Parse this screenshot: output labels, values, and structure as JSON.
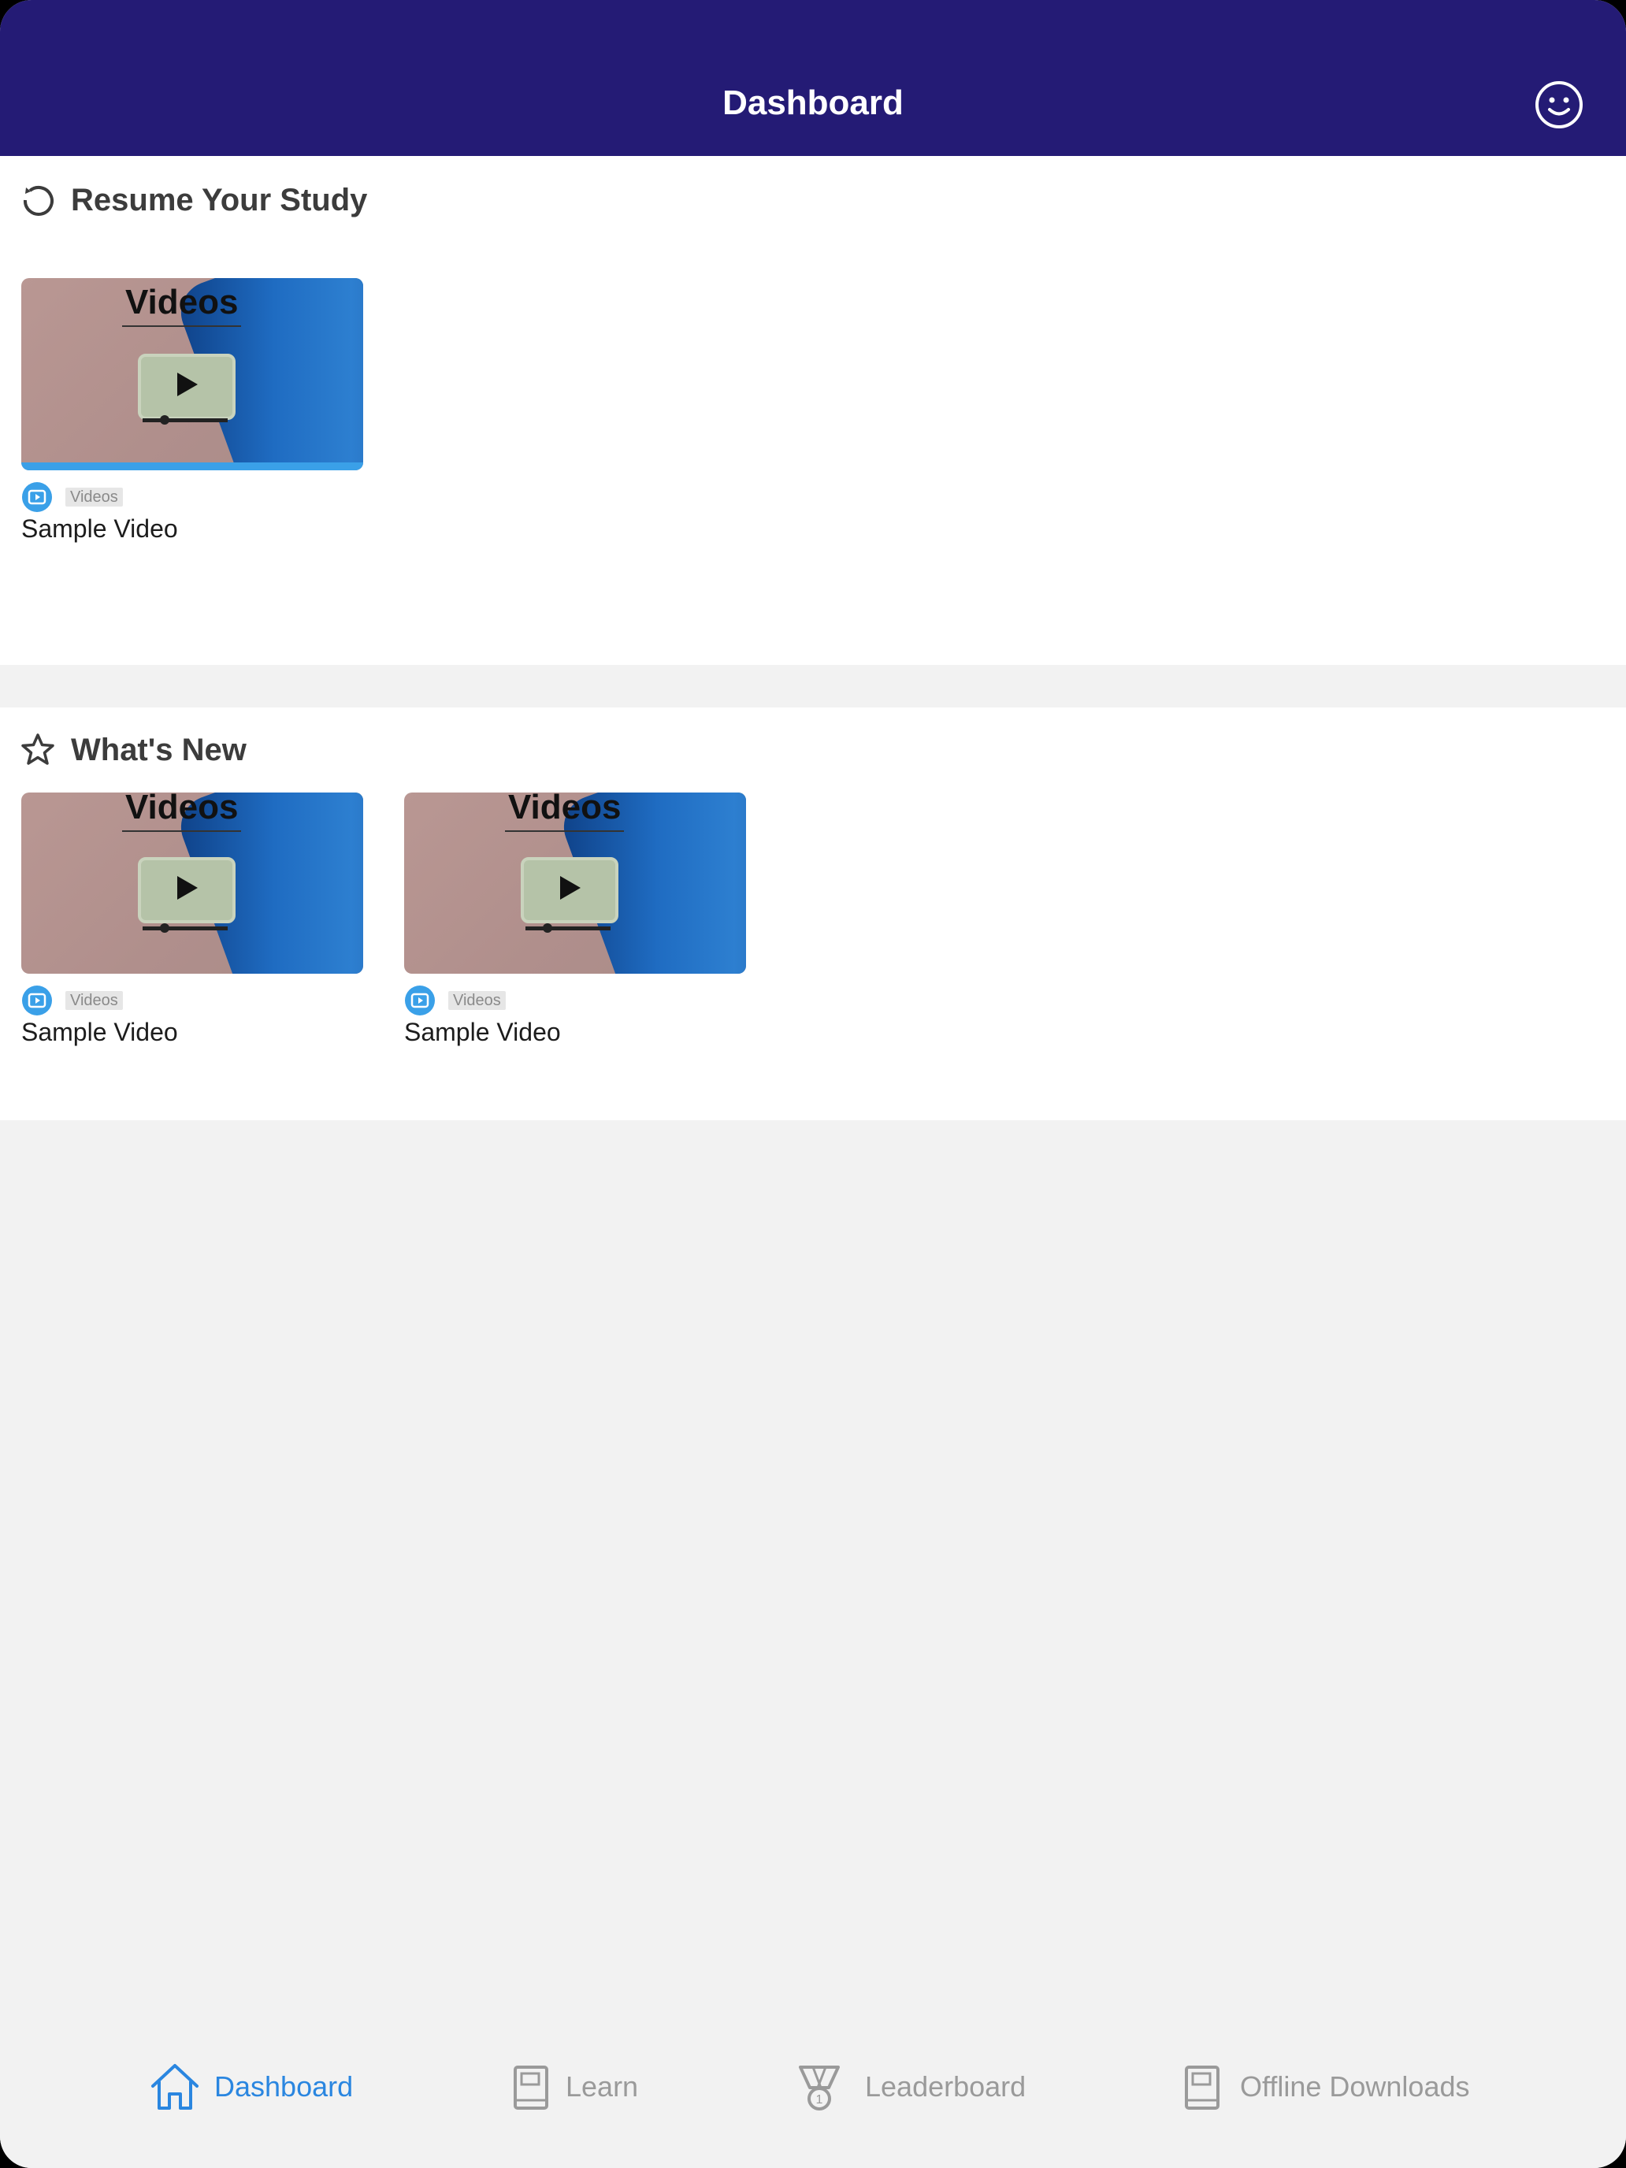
{
  "header": {
    "title": "Dashboard",
    "profile_icon": "smiley-face-icon"
  },
  "colors": {
    "header_bg": "#241b75",
    "accent": "#2a86e0",
    "video_badge": "#3aa0e8",
    "inactive": "#9a9a9a"
  },
  "resume": {
    "title": "Resume Your Study",
    "icon": "history-icon",
    "items": [
      {
        "thumb_text": "Videos",
        "tag": "Videos",
        "title": "Sample Video",
        "progress": 1.0
      }
    ]
  },
  "whats_new": {
    "title": "What's New",
    "icon": "star-icon",
    "items": [
      {
        "thumb_text": "Videos",
        "tag": "Videos",
        "title": "Sample Video"
      },
      {
        "thumb_text": "Videos",
        "tag": "Videos",
        "title": "Sample Video"
      }
    ]
  },
  "tabs": [
    {
      "label": "Dashboard",
      "icon": "home-icon",
      "active": true
    },
    {
      "label": "Learn",
      "icon": "book-icon",
      "active": false
    },
    {
      "label": "Leaderboard",
      "icon": "medal-icon",
      "active": false
    },
    {
      "label": "Offline Downloads",
      "icon": "book-icon",
      "active": false
    }
  ]
}
